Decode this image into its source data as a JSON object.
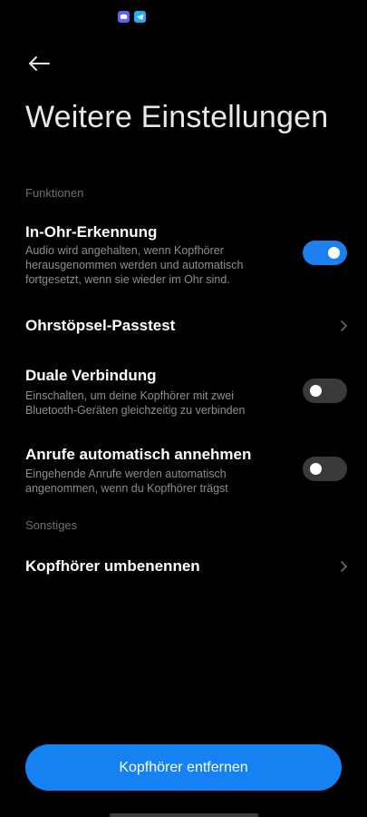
{
  "status_bar": {
    "icons": [
      "discord-icon",
      "telegram-icon"
    ]
  },
  "header": {
    "title": "Weitere Einstellungen"
  },
  "sections": {
    "functions_label": "Funktionen",
    "other_label": "Sonstiges"
  },
  "settings": {
    "in_ear": {
      "title": "In-Ohr-Erkennung",
      "description": "Audio wird angehalten, wenn Kopfhörer herausgenommen werden und automatisch fortgesetzt, wenn sie wieder im Ohr sind.",
      "enabled": true
    },
    "fit_test": {
      "title": "Ohrstöpsel-Passtest"
    },
    "dual_connection": {
      "title": "Duale Verbindung",
      "description": "Einschalten, um deine Kopfhörer mit zwei Bluetooth-Geräten gleichzeitig zu verbinden",
      "enabled": false
    },
    "auto_answer": {
      "title": "Anrufe automatisch annehmen",
      "description": "Eingehende Anrufe werden automatisch angenommen, wenn du Kopfhörer trägst",
      "enabled": false
    },
    "rename": {
      "title": "Kopfhörer umbenennen"
    }
  },
  "footer": {
    "remove_button_label": "Kopfhörer entfernen"
  },
  "colors": {
    "background": "#000000",
    "accent": "#1681f2",
    "toggle_off": "#3a3a3a",
    "secondary_text": "#8d8d8d"
  }
}
